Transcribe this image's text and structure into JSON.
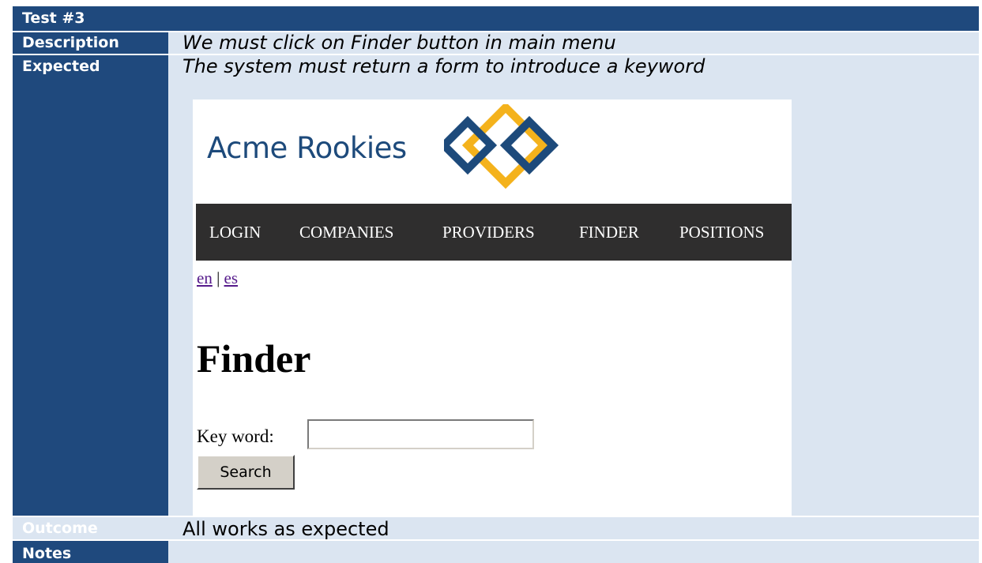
{
  "table": {
    "title": "Test #3",
    "rows": {
      "description": {
        "label": "Description",
        "value": "We must click on Finder button in main menu"
      },
      "expected": {
        "label": "Expected",
        "value": "The system must return a form to introduce a keyword"
      },
      "outcome": {
        "label": "Outcome",
        "value": "All works as expected"
      },
      "notes": {
        "label": "Notes",
        "value": ""
      }
    },
    "colors": {
      "header_bg": "#1f497d",
      "row_bg": "#dbe5f1"
    }
  },
  "screenshot": {
    "brand": "Acme Rookies",
    "logo_colors": {
      "blue": "#1d4a7b",
      "gold": "#f4b21c"
    },
    "nav": [
      "LOGIN",
      "COMPANIES",
      "PROVIDERS",
      "FINDER",
      "POSITIONS"
    ],
    "lang": {
      "en": "en",
      "separator": "|",
      "es": "es"
    },
    "heading": "Finder",
    "keyword_label": "Key word:",
    "keyword_value": "",
    "search_label": "Search"
  }
}
